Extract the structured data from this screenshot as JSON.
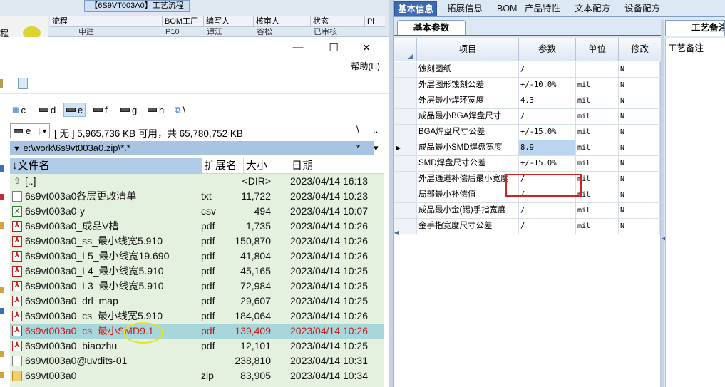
{
  "background_window": {
    "title": "【6S9VT003A0】工艺流程",
    "side_text": "程",
    "columns": [
      "流程",
      "BOM工厂",
      "编写人",
      "核审人",
      "状态",
      "Pl"
    ],
    "row": [
      "申建",
      "P10",
      "谭江",
      "谷松",
      "已审核"
    ]
  },
  "file_manager": {
    "window_buttons": {
      "minimize": "—",
      "maximize": "☐",
      "close": "✕"
    },
    "menu_help": "帮助(H)",
    "drives": [
      {
        "letter": "c"
      },
      {
        "letter": "d"
      },
      {
        "letter": "e",
        "selected": true
      },
      {
        "letter": "f"
      },
      {
        "letter": "g"
      },
      {
        "letter": "h"
      },
      {
        "letter": "\\"
      }
    ],
    "drive_combo": "e",
    "free_space": "[ 无 ]  5,965,736 KB 可用，共 65,780,752 KB",
    "btn_root": "\\",
    "btn_up": "..",
    "current_path": "e:\\work\\6s9vt003a0.zip\\*.*",
    "path_star": "*",
    "path_arrow": "▾",
    "columns": {
      "name": "文件名",
      "ext": "扩展名",
      "size": "大小",
      "date": "日期"
    },
    "sort_arrow": "↓",
    "files": [
      {
        "name": "[..]",
        "ext": "",
        "size": "<DIR>",
        "date": "2023/04/14 16:13",
        "icon": "up"
      },
      {
        "name": "6s9vt003a0各层更改清单",
        "ext": "txt",
        "size": "11,722",
        "date": "2023/04/14 10:23",
        "icon": "txt"
      },
      {
        "name": "6s9vt003a0-y",
        "ext": "csv",
        "size": "494",
        "date": "2023/04/14 10:07",
        "icon": "csv"
      },
      {
        "name": "6s9vt003a0_成品V槽",
        "ext": "pdf",
        "size": "1,735",
        "date": "2023/04/14 10:26",
        "icon": "pdf"
      },
      {
        "name": "6s9vt003a0_ss_最小线宽5.910",
        "ext": "pdf",
        "size": "150,870",
        "date": "2023/04/14 10:26",
        "icon": "pdf"
      },
      {
        "name": "6s9vt003a0_L5_最小线宽19.690",
        "ext": "pdf",
        "size": "41,804",
        "date": "2023/04/14 10:26",
        "icon": "pdf"
      },
      {
        "name": "6s9vt003a0_L4_最小线宽5.910",
        "ext": "pdf",
        "size": "45,165",
        "date": "2023/04/14 10:25",
        "icon": "pdf"
      },
      {
        "name": "6s9vt003a0_L3_最小线宽5.910",
        "ext": "pdf",
        "size": "72,984",
        "date": "2023/04/14 10:25",
        "icon": "pdf"
      },
      {
        "name": "6s9vt003a0_drl_map",
        "ext": "pdf",
        "size": "29,607",
        "date": "2023/04/14 10:25",
        "icon": "pdf"
      },
      {
        "name": "6s9vt003a0_cs_最小线宽5.910",
        "ext": "pdf",
        "size": "184,064",
        "date": "2023/04/14 10:26",
        "icon": "pdf"
      },
      {
        "name": "6s9vt003a0_cs_最小SMD9.1",
        "ext": "pdf",
        "size": "139,409",
        "date": "2023/04/14 10:26",
        "icon": "pdf",
        "selected": true
      },
      {
        "name": "6s9vt003a0_biaozhu",
        "ext": "pdf",
        "size": "12,101",
        "date": "2023/04/14 10:25",
        "icon": "pdf"
      },
      {
        "name": "6s9vt003a0@uvdits-01",
        "ext": "",
        "size": "238,810",
        "date": "2023/04/14 10:31",
        "icon": "txt"
      },
      {
        "name": "6s9vt003a0",
        "ext": "zip",
        "size": "83,905",
        "date": "2023/04/14 10:34",
        "icon": "zip"
      }
    ]
  },
  "right_panel": {
    "tabs": [
      "基本信息",
      "拓展信息",
      "BOM",
      "产品特性",
      "文本配方",
      "设备配方"
    ],
    "active_tab": "基本信息",
    "subtab": "基本参数",
    "notes_tab": "工艺备注",
    "notes_label": "工艺备注",
    "grid_columns": [
      "项目",
      "参数",
      "单位",
      "修改"
    ],
    "rows": [
      {
        "item": "蚀刻图纸",
        "param": "/",
        "unit": "",
        "mod": "N"
      },
      {
        "item": "外层图形蚀刻公差",
        "param": "+/-10.0%",
        "unit": "mil",
        "mod": "N"
      },
      {
        "item": "外层最小焊环宽度",
        "param": "4.3",
        "unit": "mil",
        "mod": "N"
      },
      {
        "item": "成品最小BGA焊盘尺寸",
        "param": "/",
        "unit": "mil",
        "mod": "N"
      },
      {
        "item": "BGA焊盘尺寸公差",
        "param": "+/-15.0%",
        "unit": "mil",
        "mod": "N"
      },
      {
        "item": "成品最小SMD焊盘宽度",
        "param": "8.9",
        "unit": "mil",
        "mod": "N",
        "current": true
      },
      {
        "item": "SMD焊盘尺寸公差",
        "param": "+/-15.0%",
        "unit": "mil",
        "mod": "N"
      },
      {
        "item": "外层通道补偿后最小宽度",
        "param": "/",
        "unit": "mil",
        "mod": "N"
      },
      {
        "item": "局部最小补偿值",
        "param": "/",
        "unit": "mil",
        "mod": "N"
      },
      {
        "item": "成品最小金(锡)手指宽度",
        "param": "/",
        "unit": "mil",
        "mod": "N"
      },
      {
        "item": "金手指宽度尺寸公差",
        "param": "/",
        "unit": "mil",
        "mod": "N"
      }
    ],
    "row_pointer": "▶"
  }
}
